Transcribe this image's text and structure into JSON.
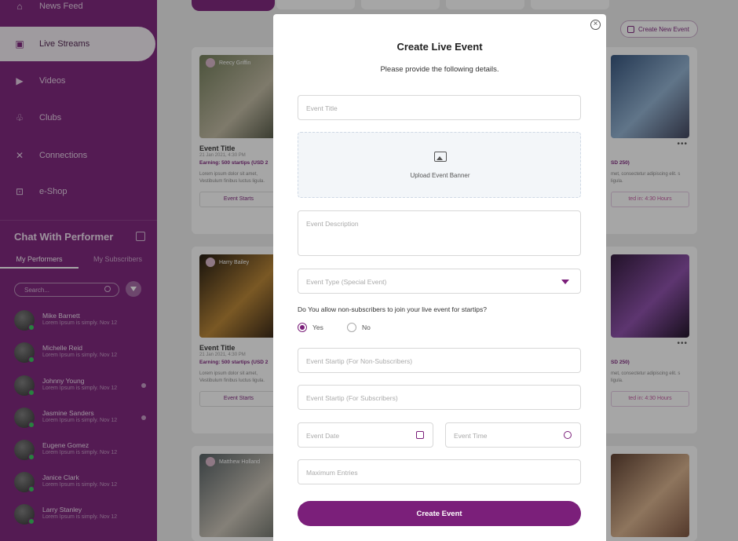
{
  "sidebar": {
    "nav": [
      {
        "label": "News Feed",
        "icon": "home-icon"
      },
      {
        "label": "Live Streams",
        "icon": "live-stream-icon",
        "active": true
      },
      {
        "label": "Videos",
        "icon": "video-icon"
      },
      {
        "label": "Clubs",
        "icon": "clubs-icon"
      },
      {
        "label": "Connections",
        "icon": "connections-icon"
      },
      {
        "label": "e-Shop",
        "icon": "shop-icon"
      }
    ],
    "chat": {
      "title": "Chat With Performer",
      "tabs": [
        "My Performers",
        "My Subscribers"
      ],
      "search_placeholder": "Search...",
      "performers": [
        {
          "name": "Mike Barnett",
          "msg": "Lorem Ipsum is simply. Nov 12",
          "unread": false
        },
        {
          "name": "Michelle Reid",
          "msg": "Lorem Ipsum is simply. Nov 12",
          "unread": false
        },
        {
          "name": "Johnny Young",
          "msg": "Lorem Ipsum is simply. Nov 12",
          "unread": true
        },
        {
          "name": "Jasmine Sanders",
          "msg": "Lorem Ipsum is simply. Nov 12",
          "unread": true
        },
        {
          "name": "Eugene Gomez",
          "msg": "Lorem Ipsum is simply. Nov 12",
          "unread": false
        },
        {
          "name": "Janice Clark",
          "msg": "Lorem Ipsum is simply. Nov 12",
          "unread": false
        },
        {
          "name": "Larry Stanley",
          "msg": "Lorem Ipsum is simply. Nov 12",
          "unread": false
        }
      ]
    }
  },
  "header": {
    "create_new_label": "Create New Event"
  },
  "cards": [
    {
      "host": "Reecy Griffin",
      "title": "Event Title",
      "date": "21 Jan 2021, 4:30 PM",
      "earning": "Earning: 500 startips (USD 2",
      "desc": "Lorem ipsum dolor sit amet, Vestibulum finibus luctus ligula.",
      "button": "Event Starts"
    },
    {
      "host": "Harry Bailey",
      "title": "Event Title",
      "date": "21 Jan 2021, 4:30 PM",
      "earning": "Earning: 500 startips (USD 2",
      "desc": "Lorem ipsum dolor sit amet, Vestibulum finibus luctus ligula.",
      "button": "Event Starts"
    },
    {
      "host": "Matthew Holland"
    }
  ],
  "right_cards": [
    {
      "earning": "SD 250)",
      "desc": "met, consectetur adipiscing elit. s ligula.",
      "button": "ted in: 4:30 Hours"
    },
    {
      "earning": "SD 250)",
      "desc": "met, consectetur adipiscing elit. s ligula.",
      "button": "ted in: 4:30 Hours"
    },
    {}
  ],
  "modal": {
    "title": "Create Live Event",
    "subtitle": "Please provide the following details.",
    "event_title_placeholder": "Event Title",
    "upload_label": "Upload Event Banner",
    "description_placeholder": "Event Description",
    "event_type_placeholder": "Event Type (Special Event)",
    "question": "Do You allow non-subscribers to join your live event for startips?",
    "radio_yes": "Yes",
    "radio_no": "No",
    "radio_selected": "Yes",
    "startip_non_sub_placeholder": "Event Startip (For Non-Subscribers)",
    "startip_sub_placeholder": "Event Startip (For Subscribers)",
    "date_placeholder": "Event Date",
    "time_placeholder": "Event Time",
    "max_entries_placeholder": "Maximum Entries",
    "submit_label": "Create Event"
  },
  "colors": {
    "accent": "#7b1f7a",
    "online": "#35c35a"
  }
}
